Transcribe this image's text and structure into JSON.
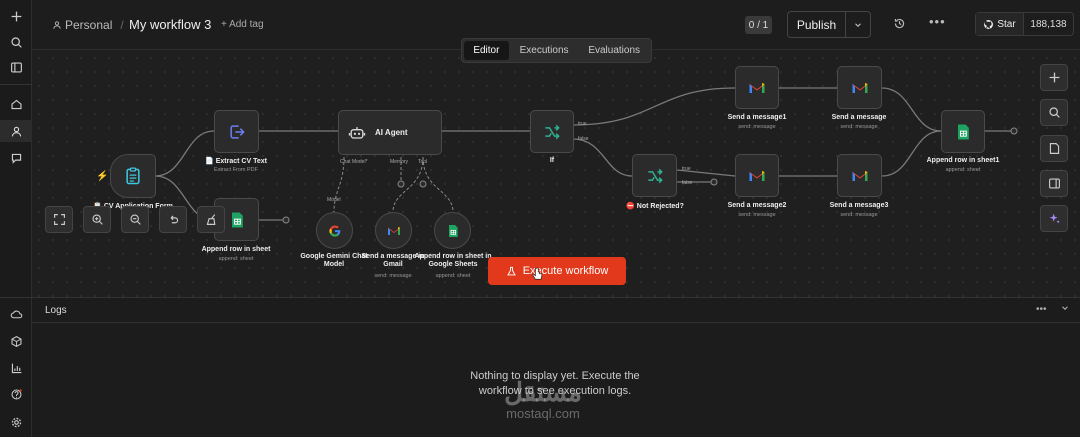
{
  "breadcrumb": {
    "project": "Personal",
    "separator": "/",
    "workflow": "My workflow 3",
    "add_tag": "+ Add tag"
  },
  "header": {
    "counter": "0 / 1",
    "publish": "Publish",
    "github_star": "Star",
    "github_count": "188,138",
    "more": "•••"
  },
  "tabs": [
    {
      "label": "Editor",
      "active": true
    },
    {
      "label": "Executions",
      "active": false
    },
    {
      "label": "Evaluations",
      "active": false
    }
  ],
  "nodes": {
    "trigger": {
      "label": "CV Application Form"
    },
    "extract": {
      "label": "Extract CV Text",
      "sub": "Extract From PDF"
    },
    "append1": {
      "label": "Append row in sheet",
      "sub": "append: sheet"
    },
    "agent": {
      "label": "AI Agent",
      "ports": [
        "Chat Model*",
        "Memory",
        "Tool"
      ]
    },
    "gemini": {
      "label": "Google Gemini Chat Model",
      "port": "Model"
    },
    "gmail_tool": {
      "label": "Send a message in Gmail",
      "sub": "send: message"
    },
    "sheets_tool": {
      "label": "Append row in sheet in Google Sheets",
      "sub": "append: sheet"
    },
    "if": {
      "label": "If",
      "ports": [
        "true",
        "false"
      ]
    },
    "not_rejected": {
      "label": "Not Rejected?",
      "ports": [
        "true",
        "false"
      ]
    },
    "msg1": {
      "label": "Send a message1",
      "sub": "send: message"
    },
    "msg": {
      "label": "Send a message",
      "sub": "send: message"
    },
    "msg2": {
      "label": "Send a message2",
      "sub": "send: message"
    },
    "msg3": {
      "label": "Send a message3",
      "sub": "send: message"
    },
    "append_sheet1": {
      "label": "Append row in sheet1",
      "sub": "append: sheet"
    }
  },
  "execute_button": "Execute workflow",
  "logs": {
    "title": "Logs",
    "empty_line1": "Nothing to display yet. Execute the",
    "empty_line2": "workflow to see execution logs."
  },
  "watermark": {
    "arabic": "مستقل",
    "latin": "mostaql.com"
  },
  "colors": {
    "accent": "#e2381c",
    "canvas": "#1f1f1f",
    "node": "#2b2b2b"
  }
}
